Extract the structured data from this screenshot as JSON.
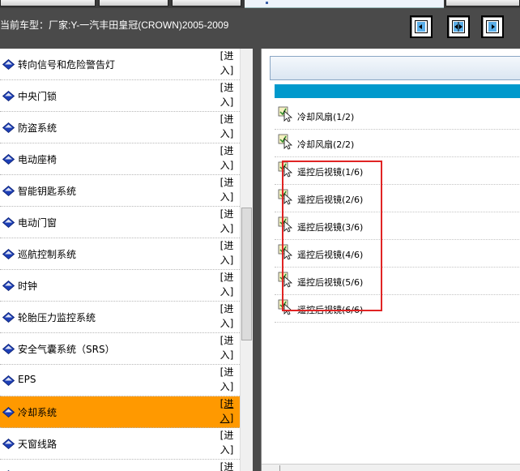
{
  "header": {
    "vehicle_label": "当前车型：厂家:Y-一汽丰田皇冠(CROWN)2005-2009"
  },
  "view_buttons": [
    {
      "icon": "layout-left-icon"
    },
    {
      "icon": "layout-split-icon"
    },
    {
      "icon": "layout-right-icon"
    }
  ],
  "nav": {
    "enter_label": "[进入]",
    "items": [
      {
        "label": "转向信号和危险警告灯",
        "selected": false
      },
      {
        "label": "中央门锁",
        "selected": false
      },
      {
        "label": "防盗系统",
        "selected": false
      },
      {
        "label": "电动座椅",
        "selected": false
      },
      {
        "label": "智能钥匙系统",
        "selected": false
      },
      {
        "label": "电动门窗",
        "selected": false
      },
      {
        "label": "巡航控制系统",
        "selected": false
      },
      {
        "label": "时钟",
        "selected": false
      },
      {
        "label": "轮胎压力监控系统",
        "selected": false
      },
      {
        "label": "安全气囊系统（SRS）",
        "selected": false
      },
      {
        "label": "EPS",
        "selected": false
      },
      {
        "label": "冷却系统",
        "selected": true
      },
      {
        "label": "天窗线路",
        "selected": false
      },
      {
        "label": "",
        "selected": false
      }
    ]
  },
  "documents": {
    "items": [
      {
        "label": "冷却风扇(1/2)"
      },
      {
        "label": "冷却风扇(2/2)"
      },
      {
        "label": "遥控后视镜(1/6)"
      },
      {
        "label": "遥控后视镜(2/6)"
      },
      {
        "label": "遥控后视镜(3/6)"
      },
      {
        "label": "遥控后视镜(4/6)"
      },
      {
        "label": "遥控后视镜(5/6)"
      },
      {
        "label": "遥控后视镜(6/6)"
      }
    ]
  },
  "colors": {
    "selected_row": "#ff9900",
    "blue_bar": "#0099cc",
    "highlight_box": "#e02424",
    "diamond_blue": "#1d3fb5"
  }
}
